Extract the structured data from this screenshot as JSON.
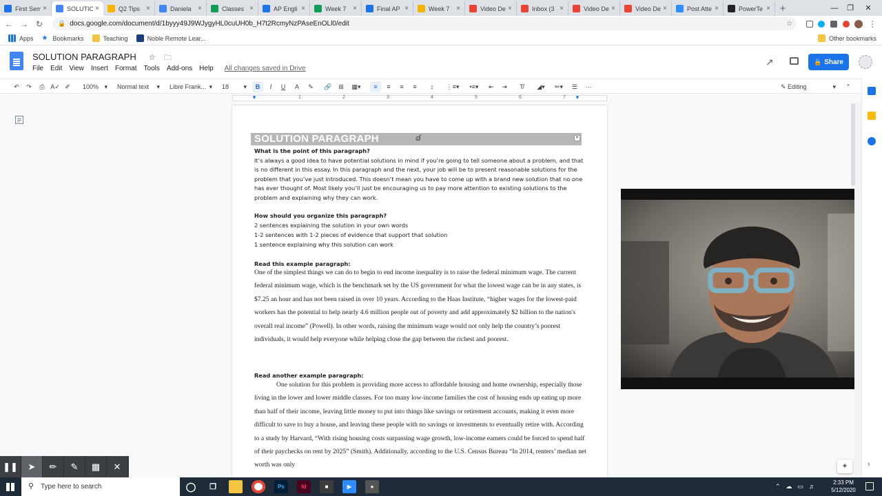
{
  "browser": {
    "tabs": [
      {
        "title": "First Sem",
        "color": "#1a73e8",
        "active": false
      },
      {
        "title": "SOLUTIO",
        "color": "#4285f4",
        "active": true
      },
      {
        "title": "Q2 Tips",
        "color": "#f4b400",
        "active": false
      },
      {
        "title": "Daniela",
        "color": "#4285f4",
        "active": false
      },
      {
        "title": "Classes",
        "color": "#0f9d58",
        "active": false
      },
      {
        "title": "AP Engli",
        "color": "#1a73e8",
        "active": false
      },
      {
        "title": "Week 7",
        "color": "#0f9d58",
        "active": false
      },
      {
        "title": "Final AP",
        "color": "#1a73e8",
        "active": false
      },
      {
        "title": "Week 7",
        "color": "#f4b400",
        "active": false
      },
      {
        "title": "Video De",
        "color": "#ea4335",
        "active": false
      },
      {
        "title": "Inbox (3",
        "color": "#ea4335",
        "active": false
      },
      {
        "title": "Video De",
        "color": "#ea4335",
        "active": false
      },
      {
        "title": "Video De",
        "color": "#ea4335",
        "active": false
      },
      {
        "title": "Post Atte",
        "color": "#2d8cff",
        "active": false
      },
      {
        "title": "PowerTe",
        "color": "#202124",
        "active": false
      }
    ],
    "url": "docs.google.com/document/d/1byyy49J9WJygyHL0cuUH0b_H7t2RcmyNzPAseEnOLl0/edit",
    "bookmarks": {
      "apps": "Apps",
      "items": [
        "Bookmarks",
        "Teaching",
        "Noble Remote Lear..."
      ],
      "other": "Other bookmarks"
    }
  },
  "docs": {
    "title": "SOLUTION PARAGRAPH",
    "menu": [
      "File",
      "Edit",
      "View",
      "Insert",
      "Format",
      "Tools",
      "Add-ons",
      "Help"
    ],
    "saved_status": "All changes saved in Drive",
    "share_label": "Share",
    "toolbar": {
      "zoom": "100%",
      "style": "Normal text",
      "font": "Libre Frank...",
      "size": "18",
      "mode": "Editing"
    },
    "ruler_numbers": [
      "1",
      "2",
      "3",
      "4",
      "5",
      "6",
      "7"
    ]
  },
  "document": {
    "heading": "SOLUTION PARAGRAPH",
    "q1": "What is the point of this paragraph?",
    "p1": "It’s always a good idea to have potential solutions in mind if you’re going to tell someone about a problem, and that is no different in this essay. In this paragraph and the next, your job will be to present reasonable solutions for the problem that you’ve just introduced. This doesn’t mean you have to come up with a brand new solution that no one has ever thought of. Most likely you’ll just be encouraging us to pay more attention to existing solutions to the problem and explaining why they can work.",
    "q2": "How should you organize this paragraph?",
    "org": [
      "2 sentences explaining the solution in your own words",
      "1-2 sentences with 1-2 pieces of evidence that support that solution",
      "1 sentence explaining why this solution can work"
    ],
    "q3": "Read this example paragraph:",
    "example1": "One of the simplest things we can do to begin to end income inequality is to raise the federal minimum wage. The current federal minimum wage, which is the benchmark set by the US government for what the lowest wage can be in any states, is $7.25 an hour and has not been raised in over 10 years. According to the Haas Institute, “higher wages for the lowest-paid workers has the potential to help nearly 4.6 million people out of poverty and add approximately $2 billion to the nation's overall real income” (Powell). In other words, raising the minimum wage would not only help the country’s poorest individuals, it would help everyone while helping close the gap between the richest and poorest.",
    "q4": "Read another example paragraph:",
    "example2": "One solution for this problem is providing more access to affordable housing and home ownership, especially those living in the lower and lower middle classes. For too many low-income families the cost of housing ends up eating up more than half of their income, leaving little money to put into things like savings or retirement accounts, making it even more difficult to save to buy a house, and leaving these people with no savings or investments to eventually retire with.  According to a study by Harvard, “With rising housing costs surpassing wage growth, low-income earners could be forced to spend half of their paychecks on rent by 2025” (Smith). Additionally, according to the U.S. Census Bureau “In 2014, renters’ median net worth was only"
  },
  "taskbar": {
    "search_placeholder": "Type here to search",
    "time": "2:33 PM",
    "date": "5/12/2020"
  }
}
